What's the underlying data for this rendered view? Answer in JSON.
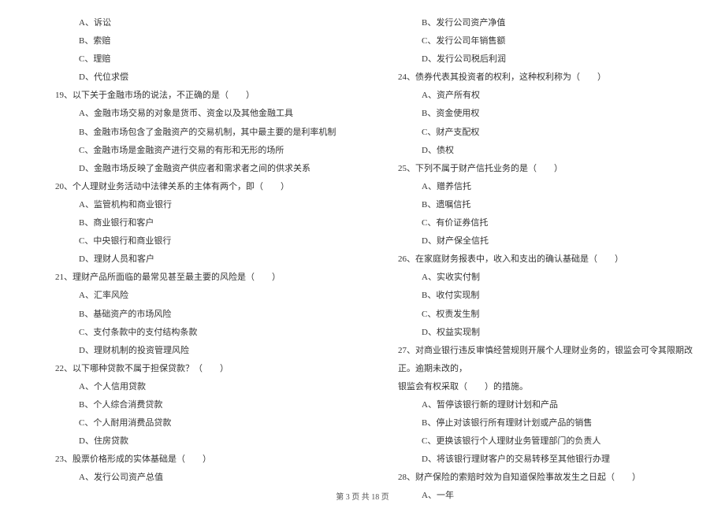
{
  "leftColumn": {
    "q18_options": [
      "A、诉讼",
      "B、索赔",
      "C、理赔",
      "D、代位求偿"
    ],
    "q19": "19、以下关于金融市场的说法，不正确的是（　　）",
    "q19_options": [
      "A、金融市场交易的对象是货币、资金以及其他金融工具",
      "B、金融市场包含了金融资产的交易机制，其中最主要的是利率机制",
      "C、金融市场是金融资产进行交易的有形和无形的场所",
      "D、金融市场反映了金融资产供应者和需求者之间的供求关系"
    ],
    "q20": "20、个人理财业务活动中法律关系的主体有两个，即（　　）",
    "q20_options": [
      "A、监管机构和商业银行",
      "B、商业银行和客户",
      "C、中央银行和商业银行",
      "D、理财人员和客户"
    ],
    "q21": "21、理财产品所面临的最常见甚至最主要的风险是（　　）",
    "q21_options": [
      "A、汇率风险",
      "B、基础资产的市场风险",
      "C、支付条款中的支付结构条款",
      "D、理财机制的投资管理风险"
    ],
    "q22": "22、以下哪种贷款不属于担保贷款？（　　）",
    "q22_options": [
      "A、个人信用贷款",
      "B、个人综合消费贷款",
      "C、个人耐用消费品贷款",
      "D、住房贷款"
    ],
    "q23": "23、股票价格形成的实体基础是（　　）",
    "q23_options": [
      "A、发行公司资产总值"
    ]
  },
  "rightColumn": {
    "q23_options_cont": [
      "B、发行公司资产净值",
      "C、发行公司年销售额",
      "D、发行公司税后利润"
    ],
    "q24": "24、债券代表其投资者的权利，这种权利称为（　　）",
    "q24_options": [
      "A、资产所有权",
      "B、资金使用权",
      "C、财产支配权",
      "D、债权"
    ],
    "q25": "25、下列不属于财产信托业务的是（　　）",
    "q25_options": [
      "A、赠养信托",
      "B、遗嘱信托",
      "C、有价证券信托",
      "D、财产保全信托"
    ],
    "q26": "26、在家庭财务报表中，收入和支出的确认基础是（　　）",
    "q26_options": [
      "A、实收实付制",
      "B、收付实现制",
      "C、权责发生制",
      "D、权益实现制"
    ],
    "q27": "27、对商业银行违反审慎经营规则开展个人理财业务的，银监会可令其限期改正。逾期未改的，",
    "q27_cont": "银监会有权采取（　　）的措施。",
    "q27_options": [
      "A、暂停该银行新的理财计划和产品",
      "B、停止对该银行所有理财计划或产品的销售",
      "C、更换该银行个人理财业务管理部门的负责人",
      "D、将该银行理财客户的交易转移至其他银行办理"
    ],
    "q28": "28、财产保险的索赔时效为自知道保险事故发生之日起（　　）",
    "q28_options": [
      "A、一年"
    ]
  },
  "footer": "第 3 页 共 18 页"
}
